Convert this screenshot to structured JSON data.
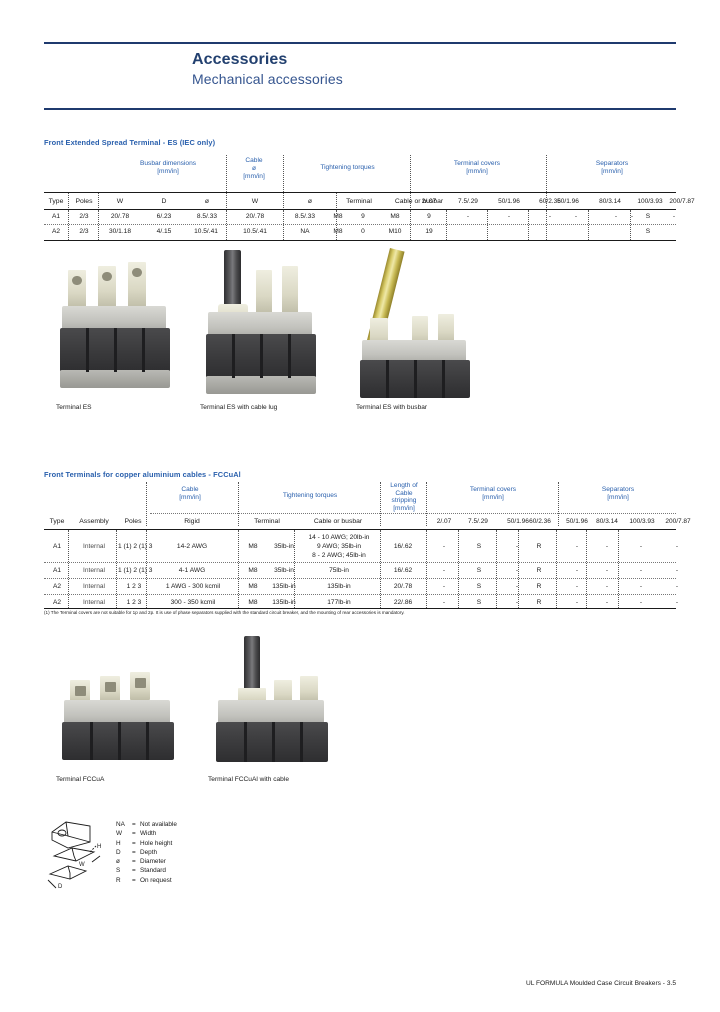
{
  "header": {
    "title": "Accessories",
    "subtitle": "Mechanical accessories"
  },
  "section1": {
    "title": "Front Extended Spread Terminal - ES (IEC only)",
    "groups": {
      "busbar": "Busbar dimensions\n[mm/in]",
      "busbar_l1": "Busbar dimensions",
      "busbar_l2": "[mm/in]",
      "cable_l1": "Cable",
      "cable_l2": "ø",
      "cable_l3": "[mm/in]",
      "torques": "Tightening torques",
      "covers_l1": "Terminal covers",
      "covers_l2": "[mm/in]",
      "separators_l1": "Separators",
      "separators_l2": "[mm/in]"
    },
    "columns": [
      "Type",
      "Poles",
      "W",
      "D",
      "ø",
      "W",
      "ø",
      "Terminal",
      "Cable or busbar"
    ],
    "numeric_columns": [
      "2/.07",
      "7.5/.29",
      "50/1.96",
      "60/2.36",
      "50/1.96",
      "80/3.14",
      "100/3.93",
      "200/7.87"
    ],
    "rows": [
      {
        "type": "A1",
        "poles": "2/3",
        "w": "20/.78",
        "d": "6/.23",
        "dia": "8.5/.33",
        "cable_w": "20/.78",
        "cable_dia": "8.5/.33",
        "tq_terminal": "M8",
        "tq_cable": "9",
        "covers": [
          "M8",
          "9",
          "-",
          "-"
        ],
        "cov": [
          "-",
          "-",
          "-",
          "-"
        ],
        "sep": [
          "-",
          "S",
          "-"
        ]
      },
      {
        "type": "A2",
        "poles": "2/3",
        "w": "30/1.18",
        "d": "4/.15",
        "dia": "10.5/.41",
        "cable_w": "10.5/.41",
        "cable_dia": "NA",
        "tq_terminal": "M8",
        "tq_cable": "M10",
        "covers": [
          "M10",
          "19",
          "",
          ""
        ],
        "cov": [
          "",
          "",
          "",
          ""
        ],
        "sep": [
          "",
          "S",
          ""
        ]
      }
    ],
    "row_values": [
      [
        "A1",
        "2/3",
        "20/.78",
        "6/.23",
        "8.5/.33",
        "20/.78",
        "8.5/.33",
        "M8",
        "9",
        "M8",
        "9",
        "-",
        "-",
        "-",
        "-",
        "-",
        "-",
        "S",
        "-"
      ],
      [
        "A2",
        "2/3",
        "30/1.18",
        "4/.15",
        "10.5/.41",
        "10.5/.41",
        "NA",
        "M8",
        "0",
        "M10",
        "19",
        "",
        "",
        "",
        "",
        "",
        "",
        "S",
        ""
      ]
    ]
  },
  "photos1": [
    {
      "caption": "Terminal ES"
    },
    {
      "caption": "Terminal ES with cable lug"
    },
    {
      "caption": "Terminal ES with busbar"
    }
  ],
  "section2": {
    "title": "Front Terminals for copper aluminium cables - FCCuAl",
    "groups": {
      "cable_l1": "Cable",
      "cable_l2": "[mm/in]",
      "torques": "Tightening torques",
      "length_l1": "Length of",
      "length_l2": "Cable",
      "length_l3": "stripping",
      "length_l4": "[mm/in]",
      "covers_l1": "Terminal covers",
      "covers_l2": "[mm/in]",
      "separators_l1": "Separators",
      "separators_l2": "[mm/in]"
    },
    "columns": [
      "Type",
      "Assembly",
      "Poles",
      "Rigid",
      "Terminal",
      "Cable or busbar"
    ],
    "numeric_columns": [
      "2/.07",
      "7.5/.29",
      "50/1.96",
      "60/2.36",
      "50/1.96",
      "80/3.14",
      "100/3.93",
      "200/7.87"
    ],
    "rows": [
      {
        "type": "A1",
        "assembly": "Internal",
        "poles": "1 (1) 2 (1) 3",
        "rigid": "14-2 AWG",
        "terminal": "M8",
        "torque": "35lb-in",
        "cable_busbar": [
          "14 - 10 AWG; 20lb-in",
          "9 AWG; 35lb-in",
          "8 - 2 AWG; 45lb-in"
        ],
        "length": "16/.62",
        "cov": [
          "-",
          "S",
          "-",
          "R",
          "-"
        ],
        "sep": [
          "-",
          "-",
          "-"
        ]
      },
      {
        "type": "A1",
        "assembly": "Internal",
        "poles": "1 (1) 2 (1) 3",
        "rigid": "4-1 AWG",
        "terminal": "M8",
        "torque": "35lb-in",
        "cable_busbar": [
          "75lb-in"
        ],
        "length": "16/.62",
        "cov": [
          "-",
          "S",
          "-",
          "R",
          "-"
        ],
        "sep": [
          "-",
          "-",
          "-"
        ]
      },
      {
        "type": "A2",
        "assembly": "Internal",
        "poles": "1 2 3",
        "rigid": "1 AWG - 300 kcmil",
        "terminal": "M8",
        "torque": "135lb-in",
        "cable_busbar": [
          "135lb-in"
        ],
        "length": "20/.78",
        "cov": [
          "-",
          "S",
          "-",
          "R",
          "-"
        ],
        "sep": [
          "-",
          "-",
          "-"
        ]
      },
      {
        "type": "A2",
        "assembly": "Internal",
        "poles": "1 2 3",
        "rigid": "300 - 350 kcmil",
        "terminal": "M8",
        "torque": "135lb-in",
        "cable_busbar": [
          "177lb-in"
        ],
        "length": "22/.86",
        "cov": [
          "-",
          "S",
          "-",
          "R",
          "-"
        ],
        "sep": [
          "-",
          "-",
          "-"
        ]
      }
    ],
    "footnote": "(1) The Terminal covers are not suitable for 1p and 2p. It is use of phase separators supplied with the standard circuit breaker, and the mounting of rear accessories is mandatory."
  },
  "photos2": [
    {
      "caption": "Terminal FCCuA"
    },
    {
      "caption": "Terminal FCCuAl with cable"
    }
  ],
  "legend": {
    "items": [
      {
        "symbol": "NA",
        "eq": "=",
        "meaning": "Not available"
      },
      {
        "symbol": "W",
        "eq": "=",
        "meaning": "Width"
      },
      {
        "symbol": "H",
        "eq": "=",
        "meaning": "Hole height"
      },
      {
        "symbol": "D",
        "eq": "=",
        "meaning": "Depth"
      },
      {
        "symbol": "ø",
        "eq": "=",
        "meaning": "Diameter"
      },
      {
        "symbol": "S",
        "eq": "=",
        "meaning": "Standard"
      },
      {
        "symbol": "R",
        "eq": "=",
        "meaning": "On request"
      }
    ],
    "drawing_labels": [
      "H",
      "W",
      "D"
    ]
  },
  "footer": {
    "text": "UL FORMULA Moulded Case Circuit Breakers - 3.5"
  },
  "colors": {
    "heading": "#22406f",
    "section_title": "#2a60ad",
    "rule": "#1f3a6e",
    "text": "#1a1a1a"
  }
}
